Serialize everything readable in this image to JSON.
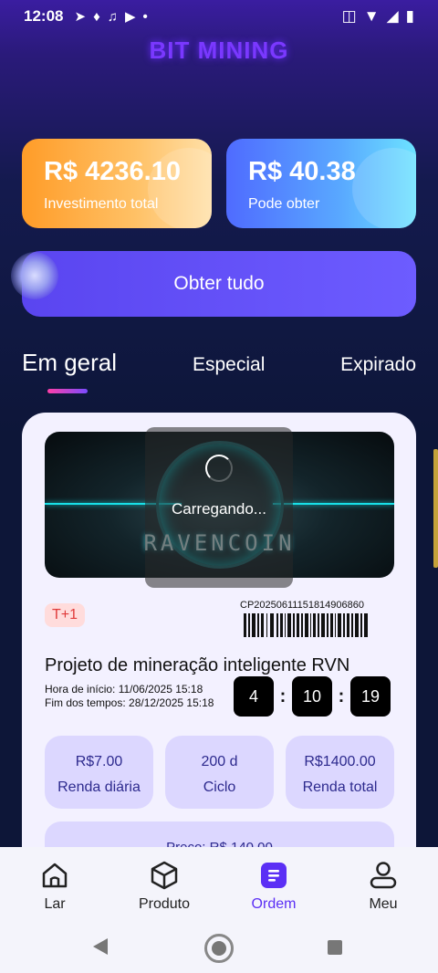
{
  "status_bar": {
    "time": "12:08"
  },
  "brand": {
    "title": "BIT MINING"
  },
  "stats": [
    {
      "amount": "R$ 4236.10",
      "label": "Investimento total",
      "color": "#ff9c28"
    },
    {
      "amount": "R$ 40.38",
      "label": "Pode obter",
      "color": "#4f6bff"
    }
  ],
  "collect_button": {
    "label": "Obter tudo"
  },
  "tabs": [
    {
      "label": "Em geral",
      "active": true
    },
    {
      "label": "Especial",
      "active": false
    },
    {
      "label": "Expirado",
      "active": false
    }
  ],
  "order": {
    "banner_text": "RAVENCOIN",
    "loading_text": "Carregando...",
    "badge": "T+1",
    "code": "CP202506111518149068​60",
    "title": "Projeto de mineração inteligente RVN",
    "start_time": "Hora de início: 11/06/2025 15:18",
    "end_time": "Fim dos tempos: 28/12/2025 15:18",
    "countdown": {
      "days": "4",
      "hours": "10",
      "minutes": "19"
    },
    "tiles": [
      {
        "value": "R$7.00",
        "label": "Renda diária"
      },
      {
        "value": "200 d",
        "label": "Ciclo"
      },
      {
        "value": "R$1400.00",
        "label": "Renda total"
      }
    ],
    "price": "Preço: R$ 140.00"
  },
  "nav": [
    {
      "label": "Lar",
      "icon": "home-icon",
      "active": false
    },
    {
      "label": "Produto",
      "icon": "cube-icon",
      "active": false
    },
    {
      "label": "Ordem",
      "icon": "order-icon",
      "active": true
    },
    {
      "label": "Meu",
      "icon": "user-icon",
      "active": false
    }
  ],
  "colors": {
    "accent": "#5b2ff5",
    "tile": "#dcd7ff"
  }
}
